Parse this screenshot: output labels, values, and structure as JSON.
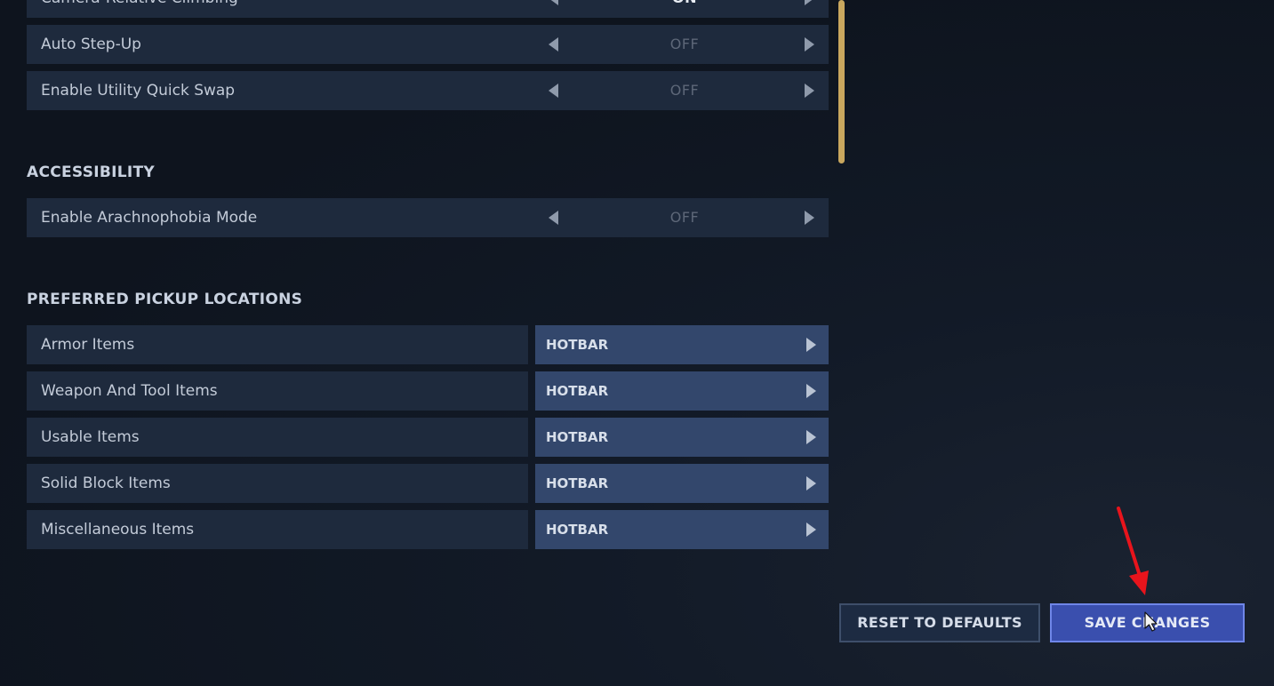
{
  "general_rows": [
    {
      "label": "Camera-Relative Climbing",
      "value": "ON",
      "active": true
    },
    {
      "label": "Auto Step-Up",
      "value": "OFF",
      "active": false
    },
    {
      "label": "Enable Utility Quick Swap",
      "value": "OFF",
      "active": false
    }
  ],
  "accessibility": {
    "title": "ACCESSIBILITY",
    "rows": [
      {
        "label": "Enable Arachnophobia Mode",
        "value": "OFF",
        "active": false
      }
    ]
  },
  "pickup": {
    "title": "PREFERRED PICKUP LOCATIONS",
    "rows": [
      {
        "label": "Armor Items",
        "value": "HOTBAR"
      },
      {
        "label": "Weapon And Tool Items",
        "value": "HOTBAR"
      },
      {
        "label": "Usable Items",
        "value": "HOTBAR"
      },
      {
        "label": "Solid Block Items",
        "value": "HOTBAR"
      },
      {
        "label": "Miscellaneous Items",
        "value": "HOTBAR"
      }
    ]
  },
  "buttons": {
    "reset": "RESET TO DEFAULTS",
    "save": "SAVE CHANGES"
  },
  "colors": {
    "row_bg": "#1e2a3d",
    "pick_value_bg": "#33476c",
    "scrollbar": "#c9a75e",
    "save_button": "#3a4fae",
    "annotation_arrow": "#e8141c"
  },
  "icons": [
    "arrow-left-icon",
    "arrow-right-icon",
    "mouse-cursor-icon",
    "red-annotation-arrow"
  ]
}
